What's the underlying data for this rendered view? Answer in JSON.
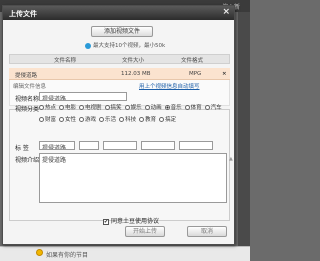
{
  "background": {
    "top_right_text": "搜 | 新",
    "bottom_text": "如果有你的节目"
  },
  "dialog": {
    "title": "上传文件",
    "close_label": "×",
    "add_button": "添加视频文件",
    "limit_text": "最大支持10个视频，最小50k",
    "table": {
      "columns": [
        "文件名称",
        "文件大小",
        "文件格式"
      ],
      "rows": [
        {
          "name": "提侵道路",
          "size": "112.03 MB",
          "format": "MPG",
          "remove": "×"
        }
      ]
    },
    "edit": {
      "header": "编辑文件信息",
      "link": "用上个视频信息自动填写",
      "name_label": "视频名称",
      "name_value": "提侵道路",
      "category_label": "视频分类",
      "categories": [
        "热点",
        "电影",
        "电视剧",
        "搞笑",
        "娱乐",
        "动画",
        "音乐",
        "体育",
        "汽车",
        "财富",
        "女性",
        "游戏",
        "乐活",
        "科技",
        "教育",
        "搞定"
      ],
      "selected_category": "音乐",
      "tags_label": "标 签",
      "tag_value": "提侵道路",
      "intro_label": "视频介绍",
      "intro_value": "提侵道路"
    },
    "agree_text": "同意土豆使用协议",
    "agree_checked": true,
    "start_button": "开始上传",
    "cancel_button": "取消"
  }
}
